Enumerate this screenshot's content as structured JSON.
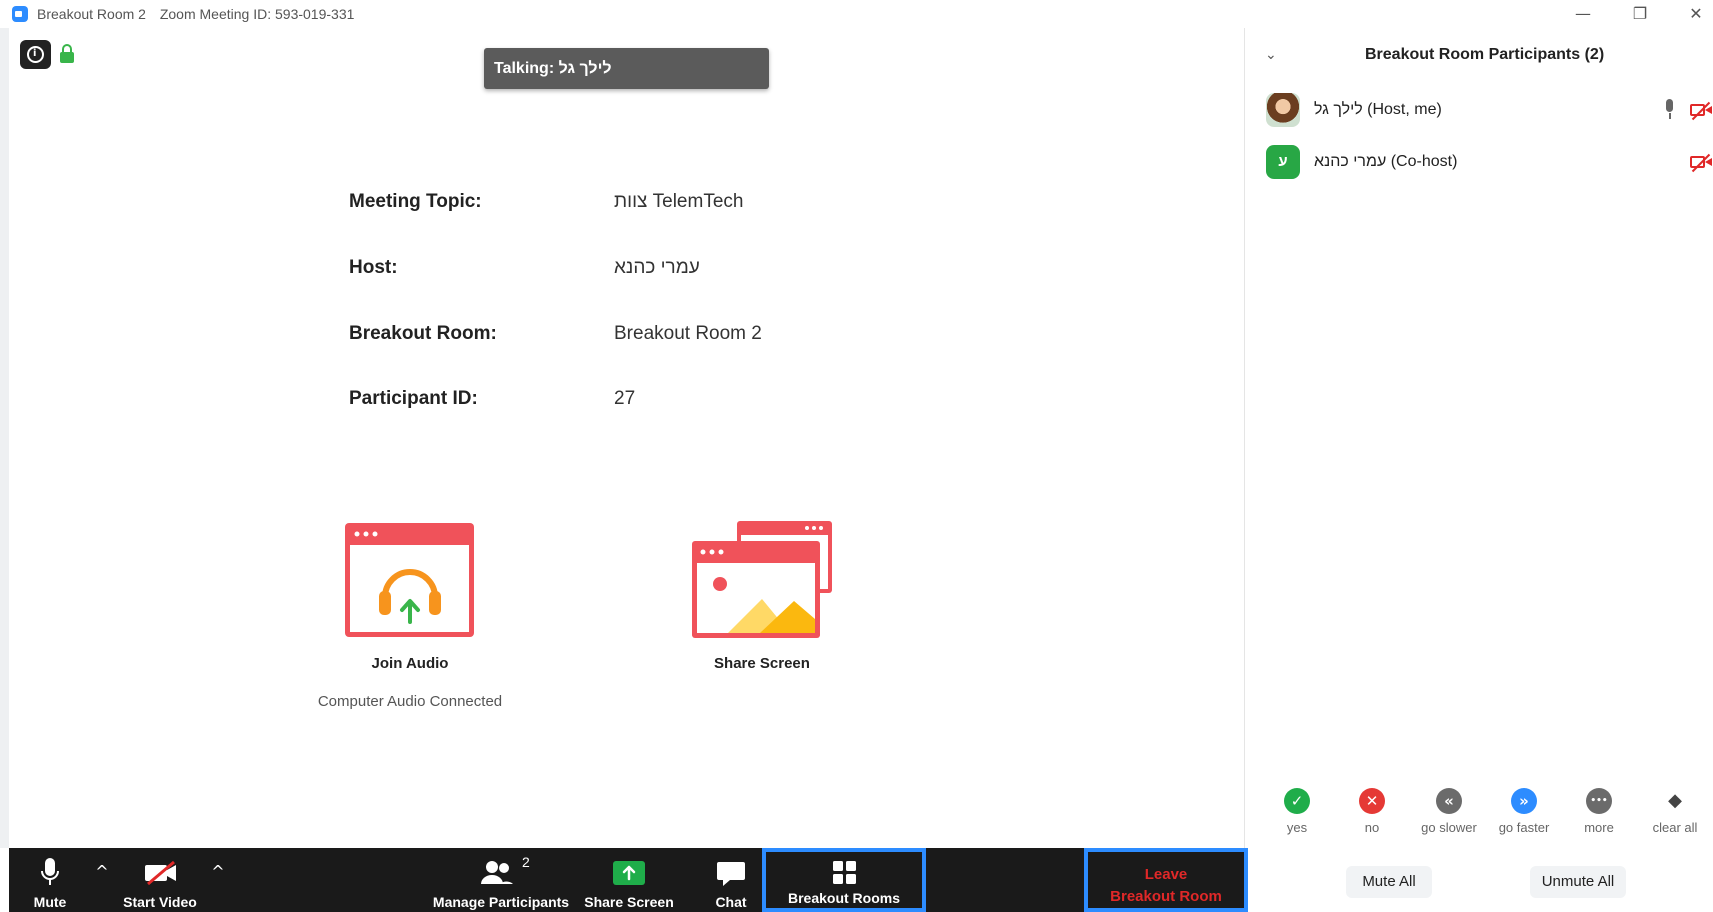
{
  "window": {
    "room_name": "Breakout Room 2",
    "meeting_id_text": "Zoom Meeting ID: 593-019-331",
    "minimize_glyph": "—",
    "restore_glyph": "❐",
    "close_glyph": "✕"
  },
  "talking": "Talking: לילך גל",
  "meeting_info": {
    "topic_label": "Meeting Topic:",
    "topic_value": "צוות TelemTech",
    "host_label": "Host:",
    "host_value": "עמרי כהנא",
    "room_label": "Breakout Room:",
    "room_value": "Breakout Room 2",
    "pid_label": "Participant ID:",
    "pid_value": "27"
  },
  "tiles": {
    "join_audio": "Join Audio",
    "audio_status": "Computer Audio Connected",
    "share_screen": "Share Screen"
  },
  "panel": {
    "chevron": "⌄",
    "title": "Breakout Room Participants (2)",
    "participants": [
      {
        "name": "לילך גל (Host, me)",
        "avatar": "photo",
        "mic": true,
        "video_off": true
      },
      {
        "name": "עמרי כהנא (Co-host)",
        "avatar_letter": "ע",
        "avatar_color": "#28a745",
        "mic": false,
        "video_off": true
      }
    ],
    "reactions": [
      {
        "label": "yes",
        "glyph": "✓",
        "color": "#1fad4a"
      },
      {
        "label": "no",
        "glyph": "✕",
        "color": "#e53935"
      },
      {
        "label": "go slower",
        "glyph": "«",
        "color": "#6b6b6b"
      },
      {
        "label": "go faster",
        "glyph": "»",
        "color": "#2d8cff"
      },
      {
        "label": "more",
        "glyph": "•••",
        "color": "#6b6b6b"
      },
      {
        "label": "clear all",
        "glyph": "◆",
        "color": "transparent"
      }
    ],
    "mute_all": "Mute All",
    "unmute_all": "Unmute All"
  },
  "toolbar": {
    "mute": "Mute",
    "start_video": "Start Video",
    "manage_participants": "Manage Participants",
    "participant_count": "2",
    "share_screen": "Share Screen",
    "chat": "Chat",
    "breakout_rooms": "Breakout Rooms",
    "leave_line1": "Leave",
    "leave_line2": "Breakout Room",
    "caret": "^"
  },
  "colors": {
    "accent": "#2d8cff",
    "danger": "#e02828",
    "toolbar_bg": "#1a1a1a",
    "tile_red": "#f0525a",
    "share_green": "#1fad4a"
  }
}
